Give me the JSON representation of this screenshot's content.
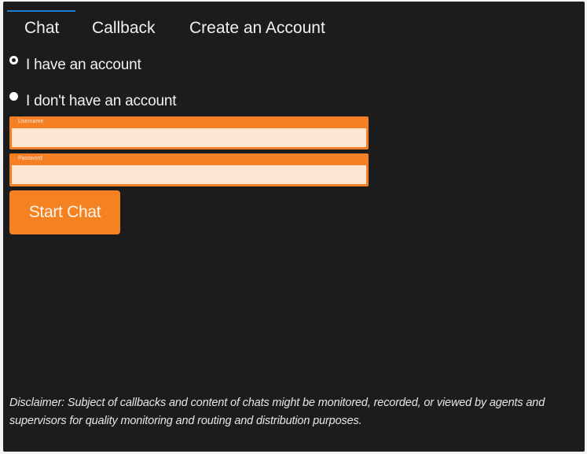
{
  "tabs": [
    {
      "label": "Chat",
      "active": true
    },
    {
      "label": "Callback",
      "active": false
    },
    {
      "label": "Create an Account",
      "active": false
    }
  ],
  "account_options": [
    {
      "label": "I have an account",
      "selected": true
    },
    {
      "label": "I don't have an account",
      "selected": false
    }
  ],
  "fields": {
    "username": {
      "label": "Username",
      "value": ""
    },
    "password": {
      "label": "Password",
      "value": ""
    }
  },
  "start_button": {
    "label": "Start Chat"
  },
  "disclaimer": "Disclaimer: Subject of callbacks and content of chats might be monitored, recorded, or viewed by agents and supervisors for quality monitoring and routing and distribution purposes.",
  "colors": {
    "background": "#1c1c1c",
    "accent_orange": "#f58220",
    "field_fill": "#fee6d2",
    "active_tab_indicator": "#1a7fd0",
    "text": "#f1f1f1"
  }
}
